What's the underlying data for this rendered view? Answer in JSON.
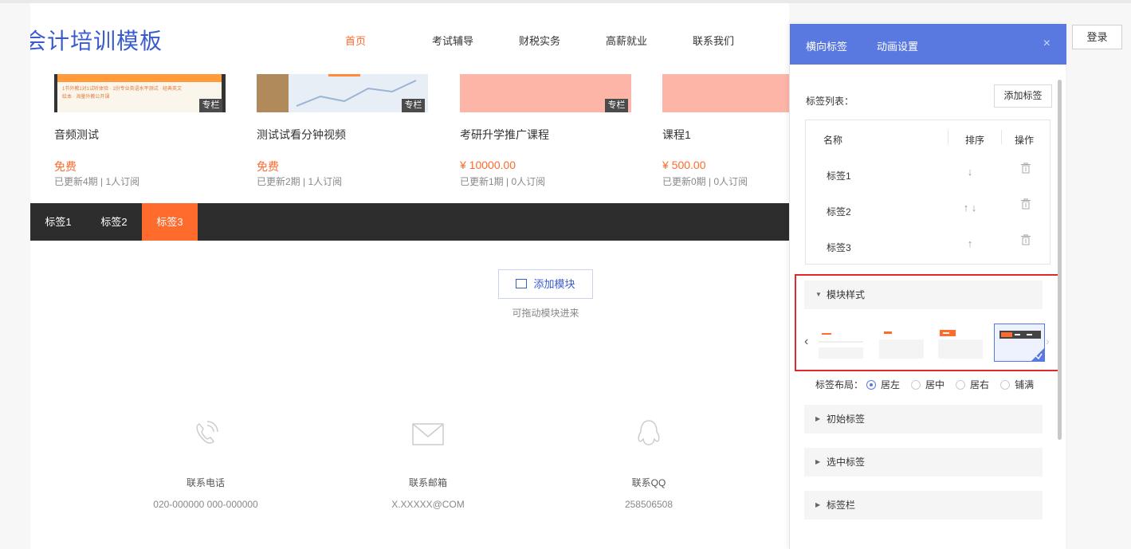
{
  "site": {
    "logo": "会计培训模板",
    "nav": [
      {
        "label": "首页",
        "active": true
      },
      {
        "label": "考试辅导",
        "active": false
      },
      {
        "label": "财税实务",
        "active": false
      },
      {
        "label": "高薪就业",
        "active": false
      },
      {
        "label": "联系我们",
        "active": false
      }
    ],
    "login": "登录"
  },
  "cards": [
    {
      "title": "音频测试",
      "price": "免费",
      "meta": "已更新4期 | 1人订阅",
      "badge": "专栏",
      "thumb_text": "1节外教1对1试听体验 · 1份专业英语水平测试 · 经典英文绘本 · 海量外教公开课"
    },
    {
      "title": "测试试看分钟视频",
      "price": "免费",
      "meta": "已更新2期 | 1人订阅",
      "badge": "专栏"
    },
    {
      "title": "考研升学推广课程",
      "price": "¥ 10000.00",
      "meta": "已更新1期 | 0人订阅",
      "badge": "专栏"
    },
    {
      "title": "课程1",
      "price": "¥ 500.00",
      "meta": "已更新0期 | 0人订阅",
      "badge": ""
    }
  ],
  "tabs": [
    {
      "label": "标签1",
      "active": false
    },
    {
      "label": "标签2",
      "active": false
    },
    {
      "label": "标签3",
      "active": true
    }
  ],
  "add_module": {
    "label": "添加模块",
    "hint": "可拖动模块进来"
  },
  "contacts": [
    {
      "icon": "phone-icon",
      "label": "联系电话",
      "value": "020-000000 000-000000"
    },
    {
      "icon": "mail-icon",
      "label": "联系邮箱",
      "value": "X.XXXXX@COM"
    },
    {
      "icon": "qq-icon",
      "label": "联系QQ",
      "value": "258506508"
    }
  ],
  "panel": {
    "tabs": [
      {
        "label": "横向标签",
        "active": true
      },
      {
        "label": "动画设置",
        "active": false
      }
    ],
    "close": "×",
    "tag_list_label": "标签列表：",
    "add_tag": "添加标签",
    "table_headers": {
      "name": "名称",
      "sort": "排序",
      "op": "操作"
    },
    "rows": [
      {
        "name": "标签1",
        "sort": "↓"
      },
      {
        "name": "标签2",
        "sort": "↑ ↓"
      },
      {
        "name": "标签3",
        "sort": "↑"
      }
    ],
    "module_style": "模块样式",
    "style_count": 4,
    "selected_style": 4,
    "layout_label": "标签布局：",
    "layout_options": [
      {
        "label": "居左",
        "checked": true
      },
      {
        "label": "居中",
        "checked": false
      },
      {
        "label": "居右",
        "checked": false
      },
      {
        "label": "铺满",
        "checked": false
      }
    ],
    "sections": [
      "初始标签",
      "选中标签",
      "标签栏"
    ]
  },
  "colors": {
    "accent": "#ff6a2d",
    "brand": "#3a5bd0",
    "panel_header": "#5a79e0",
    "highlight": "#e02929",
    "tabbar": "#2d2d2d"
  }
}
